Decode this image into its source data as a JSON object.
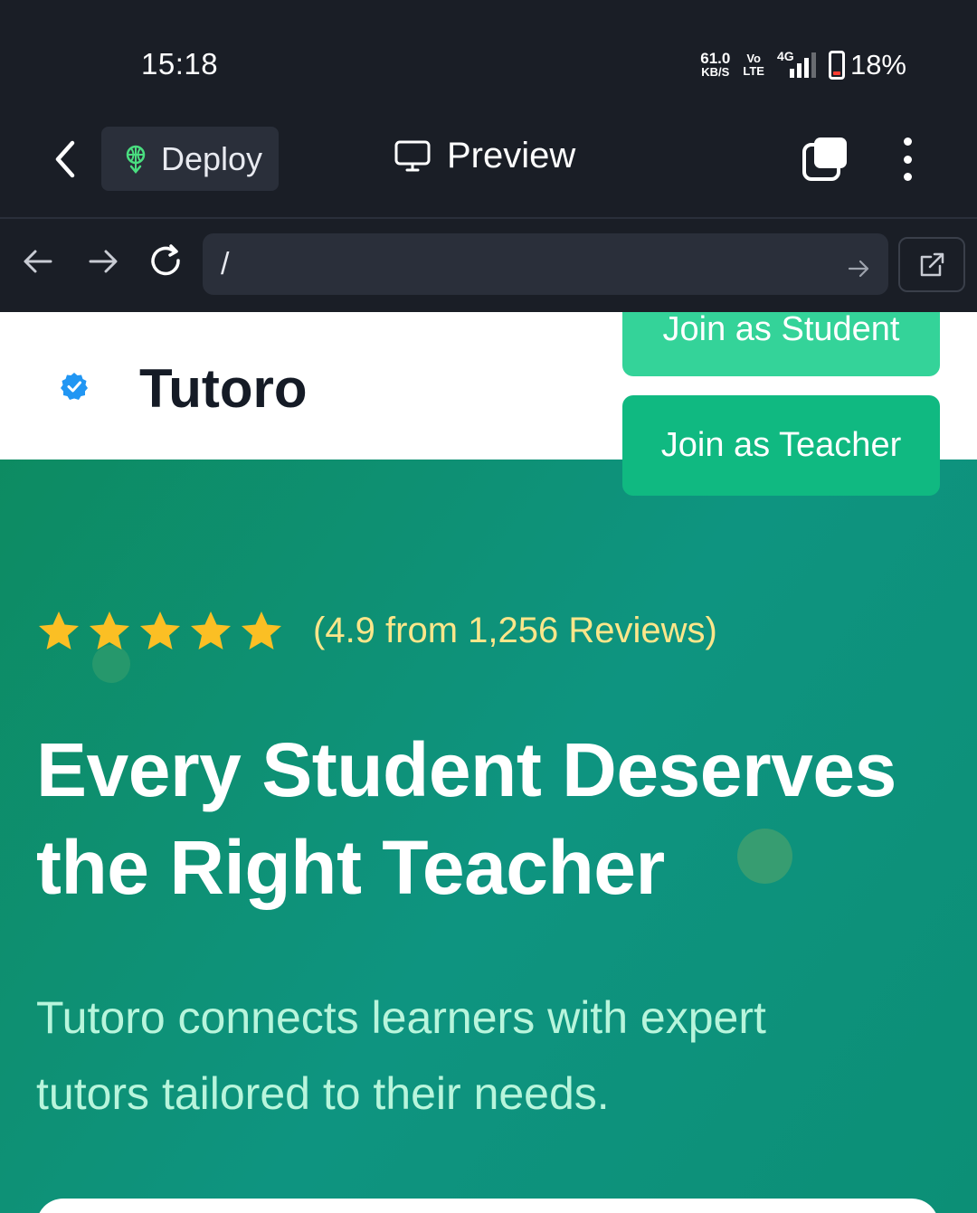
{
  "status_bar": {
    "time": "15:18",
    "net_speed": "61.0",
    "net_unit": "KB/S",
    "volte_top": "Vo",
    "volte_bottom": "LTE",
    "network": "4G",
    "battery": "18%"
  },
  "toolbar": {
    "deploy_label": "Deploy",
    "preview_label": "Preview"
  },
  "urlbar": {
    "path": "/"
  },
  "site": {
    "brand": "Tutoro",
    "join_student": "Join as Student",
    "join_teacher": "Join as Teacher",
    "rating_text": "(4.9 from 1,256 Reviews)",
    "star_count": 5,
    "headline_line1": "Every Student Deserves",
    "headline_line2": "the Right Teacher",
    "subtext_line1": "Tutoro connects learners with expert",
    "subtext_line2": "tutors tailored to their needs."
  },
  "colors": {
    "chrome_bg": "#1a1e26",
    "accent_green": "#10b981",
    "light_green": "#34d399",
    "star": "#fbbf24",
    "rating_text": "#fde68a"
  }
}
